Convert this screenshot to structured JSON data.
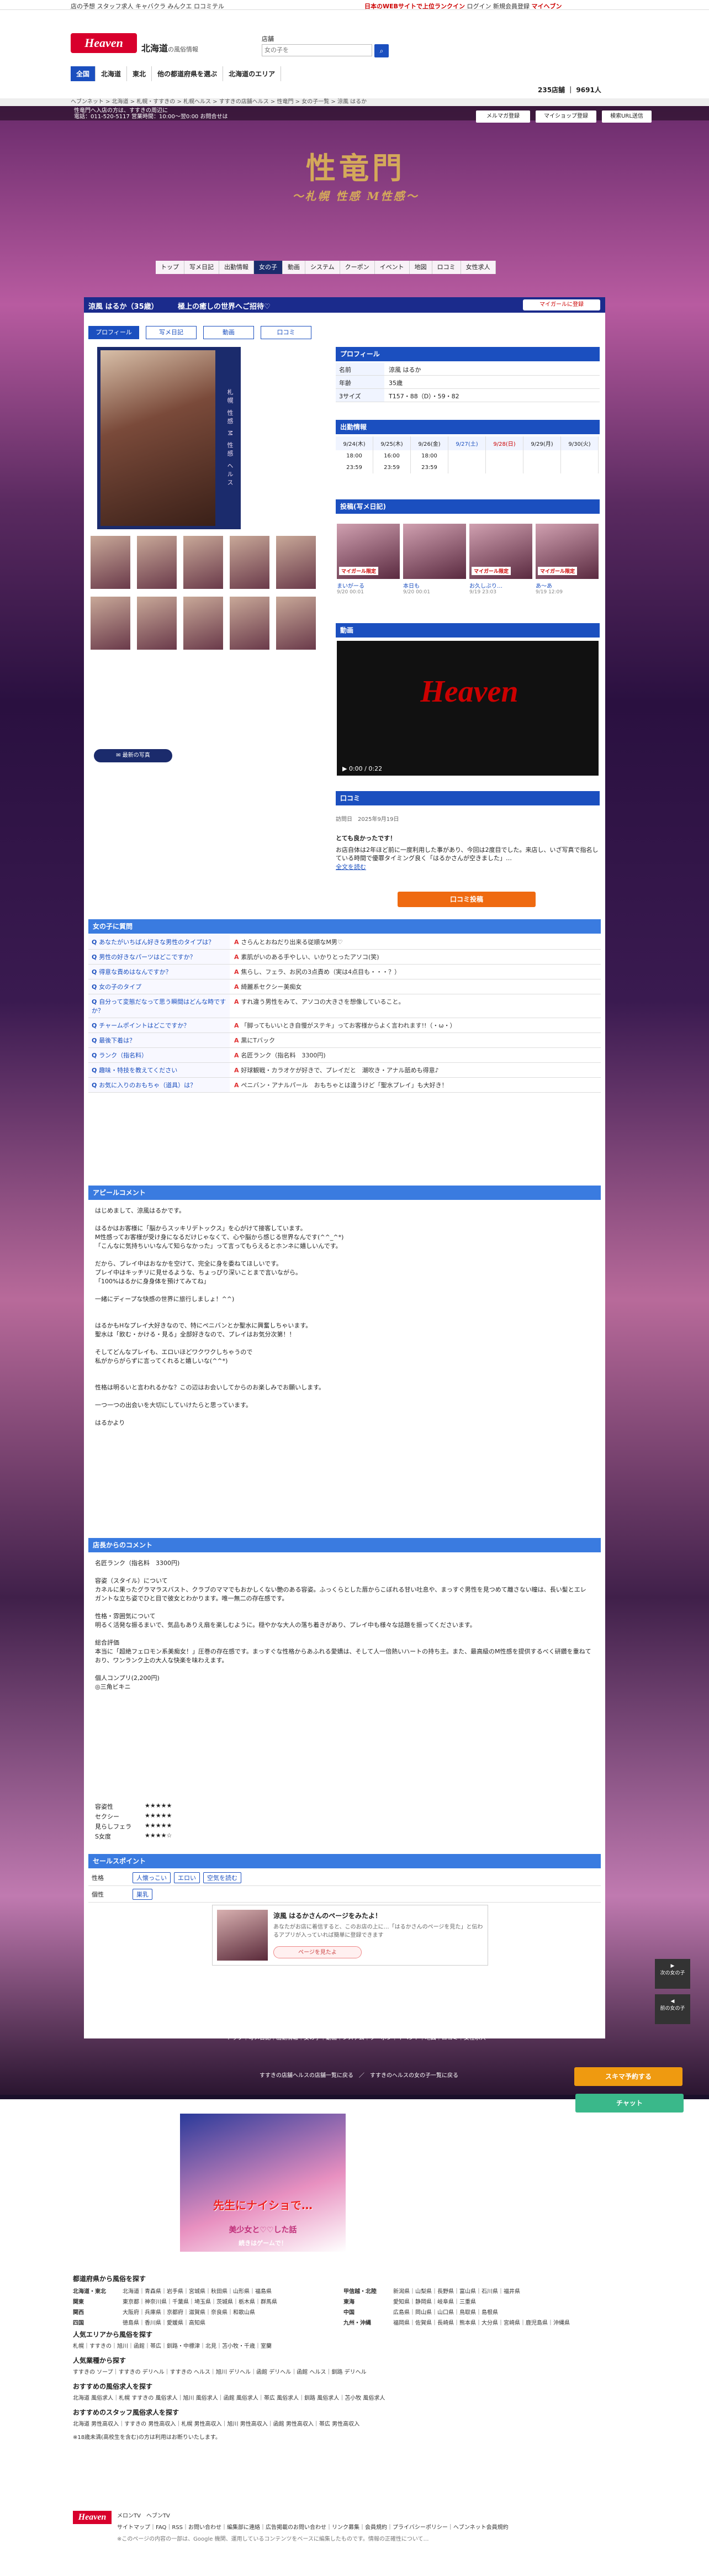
{
  "topbar": {
    "left": "店の予想 スタッフ求人 キャバクラ みんクエ ロコミテル",
    "right_pre": "日本のWEBサイトで上位ランクイン",
    "right": "ログイン 新規会員登録",
    "mypage": "マイヘブン"
  },
  "header": {
    "logo": "Heaven",
    "region": "北海道",
    "region_sub": "の風俗情報",
    "search_label": "店舗",
    "search_placeholder": "女の子を",
    "search_icon": "search-icon"
  },
  "nav1": [
    "全国",
    "北海道",
    "東北",
    "他の都道府県を選ぶ",
    "北海道のエリア"
  ],
  "count": "235店舗 ｜ 9691人",
  "breadcrumb": "ヘブンネット > 北海道 > 札幌・すすきの > 札幌ヘルス > すすきの店舗ヘルス > 性竜門 > 女の子一覧 > 涼風 はるか",
  "hero": {
    "info1": "性竜門へ入店の方は、すすきの周辺に",
    "info2": "電話：011-520-5117 営業時間：10:00〜翌0:00 お問合せは",
    "buttons": [
      "メルマガ登録",
      "マイショップ登録",
      "検索URL送信"
    ]
  },
  "shop": {
    "logo": "性竜門",
    "logo_sub": "〜札幌 性感 M性感〜",
    "nav": [
      "トップ",
      "写メ日記",
      "出勤情報",
      "女の子",
      "動画",
      "システム",
      "クーポン",
      "イベント",
      "地図",
      "ロコミ",
      "女性求人"
    ]
  },
  "profile": {
    "name": "涼風 はるか（35歳）",
    "catch": "極上の癒しの世界へご招待♡",
    "fav": "マイガールに登録",
    "tabs": [
      "プロフィール",
      "写メ日記",
      "動画",
      "口コミ"
    ],
    "side_text": "札幌 性感 M 性感 ヘルス"
  },
  "profile_box": {
    "title": "プロフィール",
    "rows": [
      [
        "名前",
        "涼風 はるか"
      ],
      [
        "年齢",
        "35歳"
      ],
      [
        "3サイズ",
        "T157・88（D）・59・82"
      ]
    ]
  },
  "schedule": {
    "title": "出勤情報",
    "days": [
      "9/24(木)",
      "9/25(木)",
      "9/26(金)",
      "9/27(土)",
      "9/28(日)",
      "9/29(月)",
      "9/30(火)"
    ],
    "start": [
      "18:00",
      "16:00",
      "18:00"
    ],
    "end": [
      "23:59",
      "23:59",
      "23:59"
    ]
  },
  "diary": {
    "title": "投稿(写メ日記)",
    "items": [
      {
        "badge": "マイガール限定",
        "t": "まいがーる",
        "d": "9/20 00:01"
      },
      {
        "badge": "",
        "t": "本日も",
        "d": "9/20 00:01"
      },
      {
        "badge": "マイガール限定",
        "t": "お久しぶり…",
        "d": "9/19 23:03"
      },
      {
        "badge": "マイガール限定",
        "t": "あ〜あ",
        "d": "9/19 12:09"
      }
    ]
  },
  "video": {
    "title": "動画",
    "logo": "Heaven",
    "time": "0:00 / 0:22"
  },
  "review": {
    "title": "口コミ",
    "date": "訪問日　2025年9月19日",
    "head": "とても良かったです！",
    "body": "お店自体は2年ほど前に一度利用した事があり、今回は2度目でした。来店し、いざ写真で指名している時間で優罪タイミング良く「はるかさんが空きました」…",
    "more": "全文を読む",
    "button": "口コミ投稿"
  },
  "qa": {
    "title": "女の子に質問",
    "rows": [
      [
        "あなたがいちばん好きな男性のタイプは？",
        "さらんとおねだり出来る従順なM男♡"
      ],
      [
        "男性の好きなパーツはどこですか？",
        "素肌がいのある手やしい、いかりとったアソコ(笑)"
      ],
      [
        "得意な責めはなんですか？",
        "焦らし、フェラ、お尻の3点責め（実は4点目も・・・？）"
      ],
      [
        "女の子のタイプ",
        "綺麗系セクシー美痴女"
      ],
      [
        "自分って変態だなって思う瞬間はどんな時ですか？",
        "すれ違う男性をみて、アソコの大きさを想像していること。"
      ],
      [
        "チャームポイントはどこですか？",
        "「脚ってもいいとき自慢がステキ」ってお客様からよく言われます!!（・ω・）"
      ],
      [
        "最後下着は？",
        "黒にTバック"
      ],
      [
        "ランク（指名料）",
        "名匠ランク（指名料　3300円)"
      ],
      [
        "趣味・特技を教えてください",
        "好球観戦・カラオケが好きで、プレイだと　潮吹き・アナル舐めも得意♪"
      ],
      [
        "お気に入りのおもちゃ（道具）は？",
        "ペニバン・アナルパール　おもちゃとは違うけど「聖水プレイ」も大好き！"
      ]
    ]
  },
  "appeal": {
    "title": "アピールコメント",
    "body": "はじめまして、涼風はるかです。\n\nはるかはお客様に「脳からスッキリデトックス」を心がけて接客しています。\nM性感ってお客様が受け身になるだけじゃなくて、心や脳から感じる世界なんです(^^_^*)\n「こんなに気持ちいいなんて知らなかった」って言ってもらえるとホンネに嬉しいんです。\n\nだから、プレイ中はおなかを空けて、完全に身を委ねてほしいです。\nプレイ中はキッチリに見せるような、ちょっぴり深いことまで言いながら。\n「100%はるかに身身体を預けてみてね」\n\n一緒にディープな快感の世界に旅行しましょ！^^)\n\n\nはるかもHなプレイ大好きなので、特にペニバンとか聖水に興奮しちゃいます。\n聖水は「飲む・かける・見る」全部好きなので、プレイはお気分次第！！\n\nそしてどんなプレイも、エロいほどワクワクしちゃうので\n私がからがらずに言ってくれると嬉しいな(^^*)\n\n\n性格は明るいと言われるかな？この辺はお会いしてからのお楽しみでお願いします。\n\n一つ一つの出会いを大切にしていけたらと思っています。\n\nはるかより"
  },
  "shopcomment": {
    "title": "店長からのコメント",
    "body": "名匠ランク（指名料　3300円)\n\n容姿（スタイル）について\nカネルに果ったグラマラスバスト、クラブのママでもおかしくない艶のある容姿。ふっくらとした唇からこぼれる甘い吐息や、まっすぐ男性を見つめて離さない瞳は、長い髪とエレガントな立ち姿でひと目で彼女とわかります。唯一無二の存在感です。\n\n性格・雰囲気について\n明るく活発な振るまいで、気品もありえ扇を楽しむように。穏やかな大人の落ち着きがあり、プレイ中も様々な話題を振ってくださいます。\n\n総合評価\n本当に「超絶フェロモン系美痴女！」圧巻の存在感です。まっすぐな性格からあふれる愛嬌は、そして人一倍熱いハートの持ち主。また、最高級のM性感を提供するべく研鑽を重ねており、ワンランク上の大人な快楽を味わえます。\n\n個人コンプリ(2,200円)\n◎三角ビキニ"
  },
  "ratings": [
    [
      "容姿性",
      "★★★★★"
    ],
    [
      "セクシー",
      "★★★★★"
    ],
    [
      "見らしフェラ",
      "★★★★★"
    ],
    [
      "S女度",
      "★★★★☆"
    ]
  ],
  "points": {
    "title": "セールスポイント",
    "rows": [
      {
        "k": "性格",
        "tags": [
          "人懐っこい",
          "エロい",
          "空気を読む"
        ]
      },
      {
        "k": "個性",
        "tags": [
          "巣乳"
        ]
      }
    ]
  },
  "banner": {
    "title": "涼風 はるかさんのページをみたよ！",
    "sub": "あなたがお店に着信すると、このお店の上に…「はるかさんのページを見た」と伝わるアプリが入っていれば簡単に登録できます",
    "btn": "ページを見たよ"
  },
  "footnav": "トップ｜写メ日記｜出勤情報｜女の子｜動画｜システム｜クーポン｜イベント｜地図｜ロコミ｜女性求人",
  "footnav2": "すすきの店舗ヘルスの店舗一覧に戻る　／　すすきのヘルスの女の子一覧に戻る",
  "side": [
    {
      "t": "次の女の子"
    },
    {
      "t": "前の女の子"
    }
  ],
  "float": {
    "sukima": "スキマ予約する",
    "chat": "チャット"
  },
  "ad": {
    "title": "先生にナイショで…",
    "sub": "美少女と♡♡した話",
    "foot": "続きはゲームで！"
  },
  "areas": {
    "title": "都道府県から風俗を探す",
    "rows": [
      [
        "北海道・東北",
        "北海道｜青森県｜岩手県｜宮城県｜秋田県｜山形県｜福島県",
        "甲信越・北陸",
        "新潟県｜山梨県｜長野県｜富山県｜石川県｜福井県"
      ],
      [
        "関東",
        "東京都｜神奈川県｜千葉県｜埼玉県｜茨城県｜栃木県｜群馬県",
        "東海",
        "愛知県｜静岡県｜岐阜県｜三重県"
      ],
      [
        "関西",
        "大阪府｜兵庫県｜京都府｜滋賀県｜奈良県｜和歌山県",
        "中国",
        "広島県｜岡山県｜山口県｜鳥取県｜島根県"
      ],
      [
        "四国",
        "徳島県｜香川県｜愛媛県｜高知県",
        "九州・沖縄",
        "福岡県｜佐賀県｜長崎県｜熊本県｜大分県｜宮崎県｜鹿児島県｜沖縄県"
      ]
    ],
    "t2": "人気エリアから風俗を探す",
    "p2": "札幌｜すすきの｜旭川｜函館｜帯広｜釧路・中標津｜北見｜苫小牧・千歳｜室蘭",
    "t3": "人気業種から探す",
    "p3": "すすきの ソープ｜すすきの デリヘル｜すすきの ヘルス｜旭川 デリヘル｜函館 デリヘル｜函館 ヘルス｜釧路 デリヘル",
    "t4": "おすすめの風俗求人を探す",
    "p4": "北海道 風俗求人｜札幌 すすきの 風俗求人｜旭川 風俗求人｜函館 風俗求人｜帯広 風俗求人｜釧路 風俗求人｜苫小牧 風俗求人",
    "t5": "おすすめのスタッフ風俗求人を探す",
    "p5": "北海道 男性高収入｜すすきの 男性高収入｜札幌 男性高収入｜旭川 男性高収入｜函館 男性高収入｜帯広 男性高収入",
    "note": "※18歳未満(高校生を含む)の方は利用はお断りいたします。"
  },
  "foot": {
    "logo": "Heaven",
    "links": "サイトマップ｜FAQ｜RSS｜お問い合わせ｜編集部に連絡｜広告掲載のお問い合わせ｜リンク募集｜会員規約｜プライバシーポリシー｜ヘブンネット会員規約",
    "copy": "※このページの内容の一部は、Google 機関、運用しているコンテンツをベースに編集したものです。情報の正確性について…",
    "social": "メロンTV　ヘブンTV"
  }
}
